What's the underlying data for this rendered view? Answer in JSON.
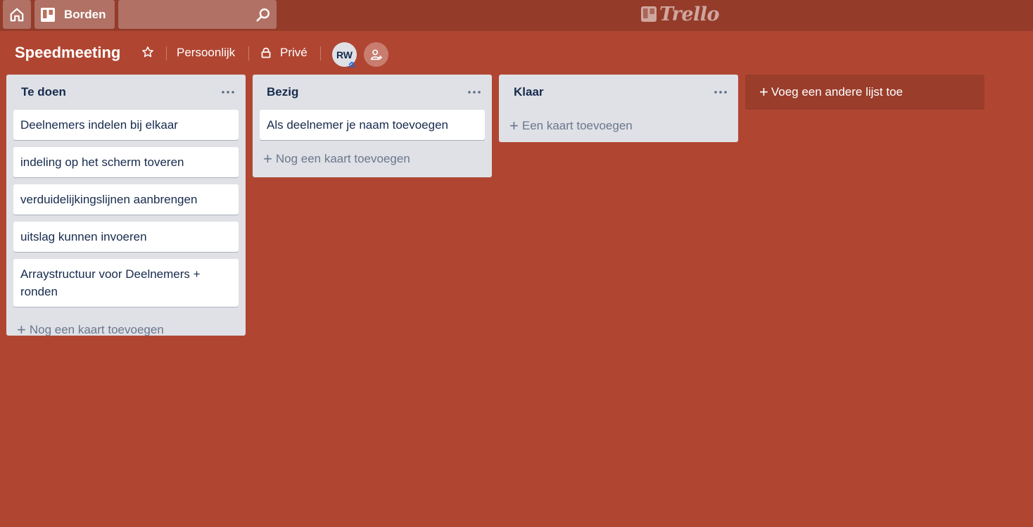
{
  "header": {
    "boards_label": "Borden",
    "search_placeholder": "",
    "logo_text": "Trello"
  },
  "board": {
    "title": "Speedmeeting",
    "team_label": "Persoonlijk",
    "visibility_label": "Privé",
    "member_initials": "RW"
  },
  "lists": [
    {
      "title": "Te doen",
      "cards": [
        "Deelnemers indelen bij elkaar",
        "indeling op het scherm toveren",
        "verduidelijkingslijnen aanbrengen",
        "uitslag kunnen invoeren",
        "Arraystructuur voor Deelnemers + ronden"
      ],
      "add_label": "Nog een kaart toevoegen"
    },
    {
      "title": "Bezig",
      "cards": [
        "Als deelnemer je naam toevoegen"
      ],
      "add_label": "Nog een kaart toevoegen"
    },
    {
      "title": "Klaar",
      "cards": [],
      "add_label": "Een kaart toevoegen"
    }
  ],
  "add_list_label": "Voeg een andere lijst toe",
  "colors": {
    "board_background": "#b04632",
    "header_background": "#943b2a",
    "list_background": "#dfe1e6",
    "card_background": "#ffffff"
  }
}
